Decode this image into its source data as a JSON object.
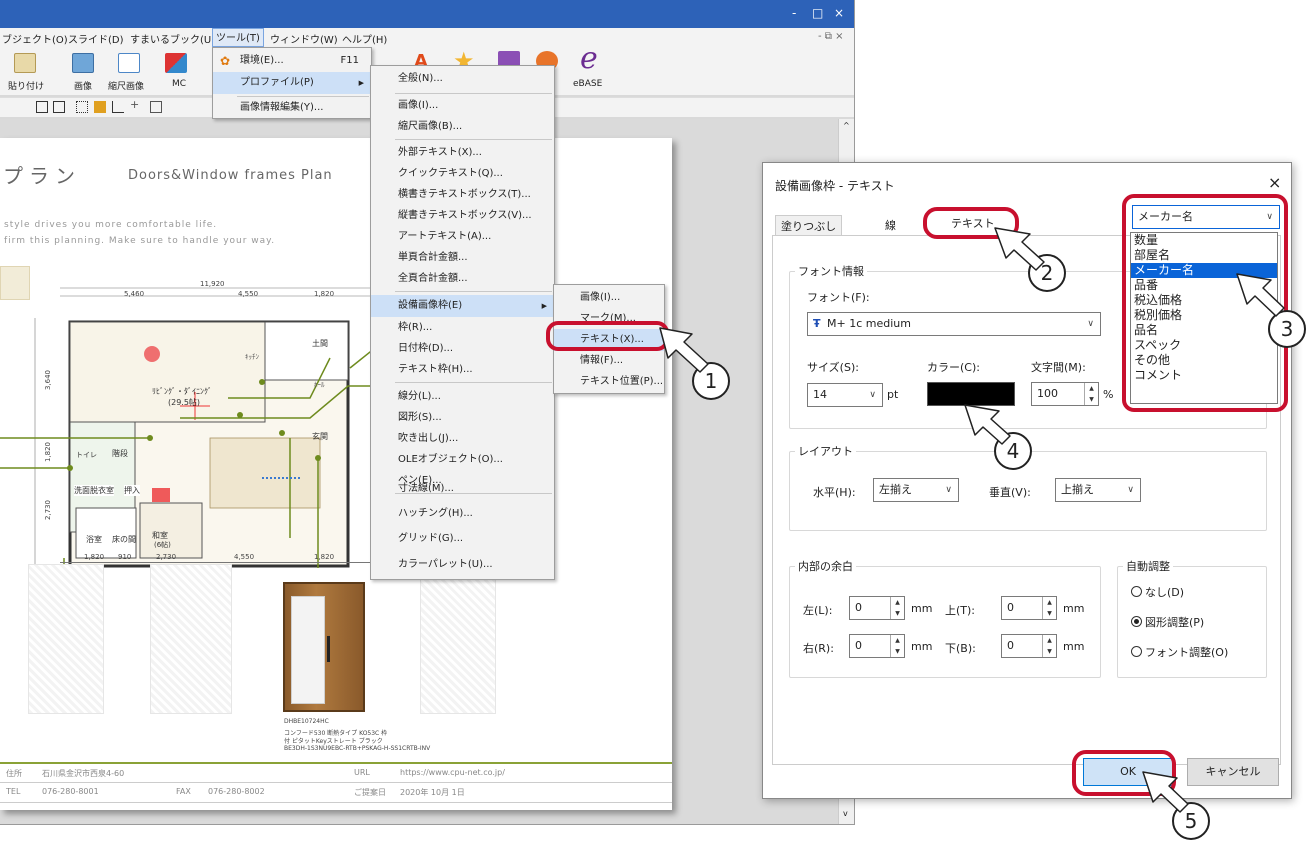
{
  "window": {
    "controls": [
      "-",
      "□",
      "×"
    ],
    "mdi_controls": "- ⧉ ×"
  },
  "menubar": [
    "ブジェクト(O)",
    "スライド(D)",
    "すまいるブック(U)",
    "ツール(T)",
    "ウィンドウ(W)",
    "ヘルプ(H)"
  ],
  "ribbon": {
    "paste": "貼り付け",
    "image": "画像",
    "scaled_image": "縮尺画像",
    "mc": "MC",
    "ebase": "eBASE"
  },
  "tools_menu": {
    "items": [
      {
        "label": "環境(E)...",
        "shortcut": "F11"
      },
      {
        "label": "プロファイル(P)"
      },
      {
        "label": "画像情報編集(Y)..."
      }
    ]
  },
  "profile_menu": [
    "全般(N)...",
    "画像(I)...",
    "縮尺画像(B)...",
    "外部テキスト(X)...",
    "クイックテキスト(Q)...",
    "横書きテキストボックス(T)...",
    "縦書きテキストボックス(V)...",
    "アートテキスト(A)...",
    "単頁合計金額...",
    "全頁合計金額...",
    "設備画像枠(E)",
    "枠(R)...",
    "日付枠(D)...",
    "テキスト枠(H)...",
    "線分(L)...",
    "図形(S)...",
    "吹き出し(J)...",
    "OLEオブジェクト(O)...",
    "ペン(E)...",
    "寸法線(M)...",
    "ハッチング(H)...",
    "グリッド(G)...",
    "カラーパレット(U)..."
  ],
  "equip_submenu": [
    "画像(I)...",
    "マーク(M)...",
    "テキスト(X)...",
    "情報(F)...",
    "テキスト位置(P)..."
  ],
  "page": {
    "title_jp": "プラン",
    "title_en": "Doors&Window frames Plan",
    "tagline1": "style drives you more comfortable life.",
    "tagline2": "firm this planning. Make sure to handle your way.",
    "dims_top": [
      "11,920",
      "5,460",
      "4,550",
      "1,820"
    ],
    "dims_bottom": [
      "1,820",
      "910",
      "2,730",
      "4,550",
      "1,820"
    ],
    "dims_left": [
      "3,640",
      "1,820",
      "1,820",
      "2,730"
    ],
    "room_ldk": "ﾘﾋﾞﾝｸﾞ・ﾀﾞｲﾆﾝｸﾞ",
    "room_ldk_size": "(29.5帖)",
    "room_kitchen": "ｷｯﾁﾝ",
    "room_entrance": "玄関",
    "room_stairs": "階段",
    "room_toilet": "トイレ",
    "room_storage": "土間",
    "room_hall": "ﾎｰﾙ",
    "room_washroom": "洗面脱衣室",
    "room_closet": "押入",
    "room_bath": "浴室",
    "room_tokonoma": "床の間",
    "room_washitsu": "和室",
    "room_washitsu_size": "(6帖)",
    "door_code": "DHBE10724HC",
    "door_note1": "コンフード530 断熱タイプ KO53C 枠",
    "door_note2": "付 ピタットKeyストレート ブラック",
    "door_note3": "BE3DH-1S3NU9EBC-RTB+PSKAG-H-SS1CRTB-INV",
    "footer": {
      "addr_label": "住所",
      "addr": "石川県金沢市西泉4-60",
      "url_label": "URL",
      "url": "https://www.cpu-net.co.jp/",
      "tel_label": "TEL",
      "tel": "076-280-8001",
      "fax_label": "FAX",
      "fax": "076-280-8002",
      "date_label": "ご提案日",
      "date": "2020年 10月 1日"
    }
  },
  "dialog": {
    "title": "設備画像枠 - テキスト",
    "close": "×",
    "tabs": [
      "塗りつぶし",
      "線",
      "テキスト"
    ],
    "font_group": "フォント情報",
    "font_label": "フォント(F):",
    "font_value": "M+ 1c medium",
    "font_icon": "Ŧ",
    "size_label": "サイズ(S):",
    "size_value": "14",
    "size_unit": "pt",
    "color_label": "カラー(C):",
    "color_value": "#000000",
    "spacing_label": "文字間(M):",
    "spacing_value": "100",
    "spacing_unit": "%",
    "layout_group": "レイアウト",
    "horiz_label": "水平(H):",
    "horiz_value": "左揃え",
    "vert_label": "垂直(V):",
    "vert_value": "上揃え",
    "margin_group": "内部の余白",
    "left_label": "左(L):",
    "left_value": "0",
    "top_label": "上(T):",
    "top_value": "0",
    "right_label": "右(R):",
    "right_value": "0",
    "bottom_label": "下(B):",
    "bottom_value": "0",
    "mm": "mm",
    "auto_group": "自動調整",
    "auto_options": [
      "なし(D)",
      "図形調整(P)",
      "フォント調整(O)"
    ],
    "auto_selected": 1,
    "ok": "OK",
    "cancel": "キャンセル",
    "combo_value": "メーカー名",
    "combo_options": [
      "数量",
      "部屋名",
      "メーカー名",
      "品番",
      "税込価格",
      "税別価格",
      "品名",
      "スペック",
      "その他",
      "コメント"
    ],
    "combo_selected": 2
  },
  "callouts": [
    "1",
    "2",
    "3",
    "4",
    "5"
  ],
  "colors": {
    "highlight": "#c8102e",
    "title_blue": "#2d62b8",
    "select_blue": "#0a64d8",
    "plan_green": "#6e8b1e"
  }
}
